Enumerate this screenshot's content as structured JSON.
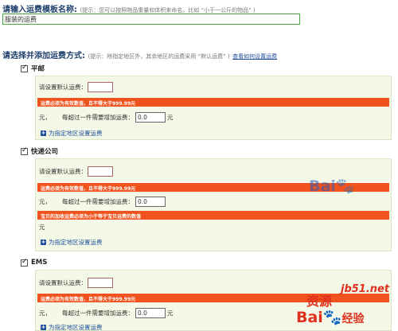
{
  "template_name": {
    "label": "请输入运费模板名称:",
    "hint": "(提示：您可以按照物品重量和体积来命名。比如 “小于一公斤的物品” )",
    "value": "服装的运费"
  },
  "methods_section": {
    "label": "请选择并添加运费方式:",
    "hint": "(提示：除指定地区外，其余地区的运费采用 “默认运费” )",
    "link": "查看如何设置运费"
  },
  "methods": [
    {
      "name": "平邮",
      "default_fee_label": "请设置默认运费：",
      "error": "运费必须为有效数值，且不得大于999.99元",
      "unit_left": "元，",
      "per_item_label": "每超过一件需要增加运费：",
      "per_item_value": "0.0",
      "unit_right": "元",
      "region_link": "为指定地区设置运费"
    },
    {
      "name": "快递公司",
      "default_fee_label": "请设置默认运费：",
      "error": "运费必须为有效数值，且不得大于999.99元",
      "unit_left": "元，",
      "per_item_label": "每超过一件需要增加运费：",
      "per_item_value": "0.0",
      "error2": "宝贝的加收运费必须为小于等于宝贝运费的数值",
      "unit_bottom": "元",
      "region_link": "为指定地区设置运费"
    },
    {
      "name": "EMS",
      "default_fee_label": "请设置默认运费：",
      "error": "运费必须为有效数值，且不得大于999.99元",
      "unit_left": "元，",
      "per_item_label": "每超过一件需要增加运费：",
      "per_item_value": "0.0",
      "unit_right": "元",
      "region_link": "为指定地区设置运费"
    }
  ],
  "watermarks": {
    "baidu_mid": "Bai",
    "site": "jb51.net",
    "baidu_bottom": "Bai",
    "cn": "资源",
    "jingyan": "经验"
  }
}
